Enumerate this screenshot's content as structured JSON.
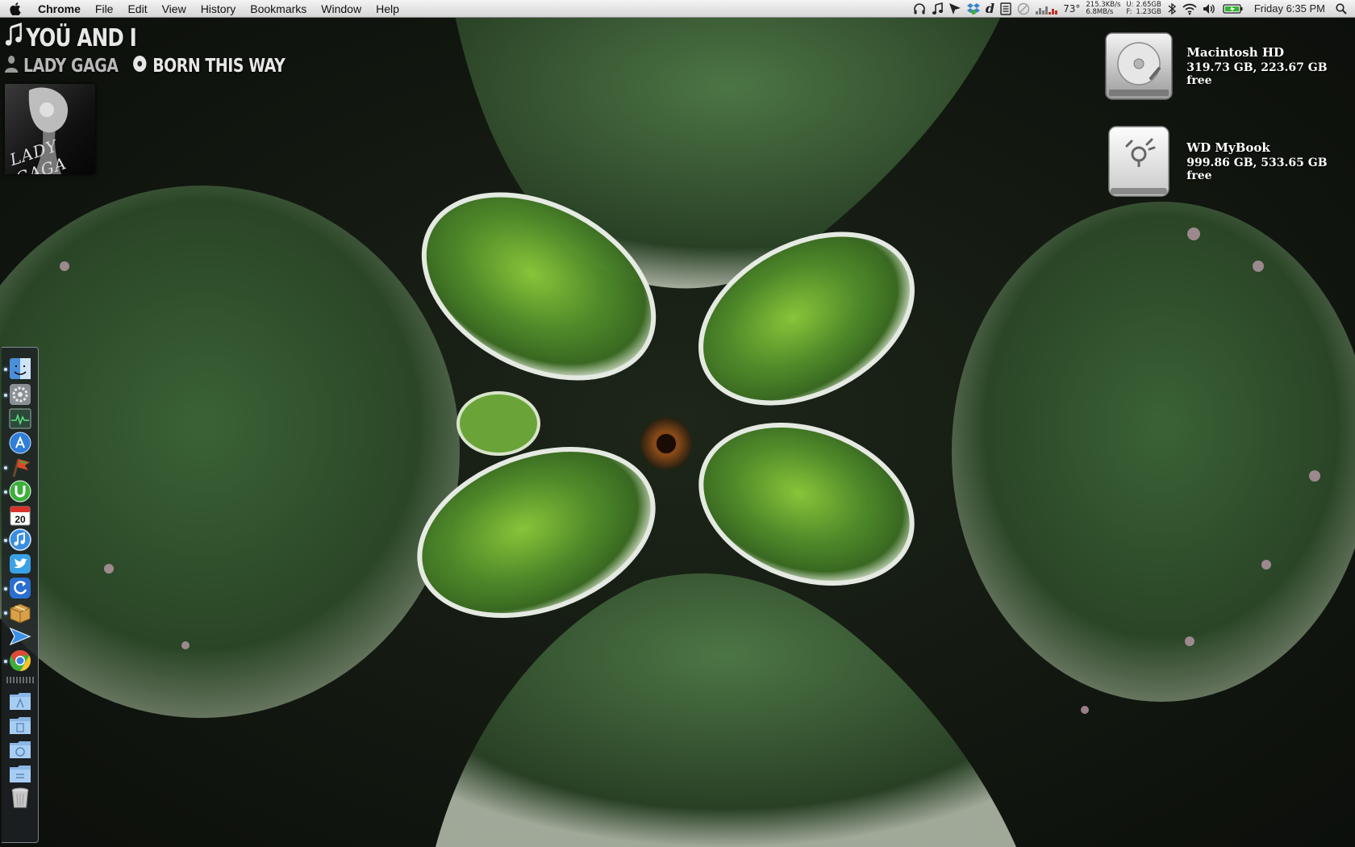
{
  "menubar": {
    "app_name": "Chrome",
    "menus": [
      "File",
      "Edit",
      "View",
      "History",
      "Bookmarks",
      "Window",
      "Help"
    ],
    "status": {
      "temperature": "73°",
      "net_up": "215.3KB/s",
      "net_down": "6.8MB/s",
      "mem_used_label": "U:",
      "mem_free_label": "F:",
      "mem_used": "2.65GB",
      "mem_free": "1.23GB",
      "clock": "Friday 6:35 PM"
    },
    "status_icons": [
      "headphones-icon",
      "music-note-icon",
      "cursor-icon",
      "dropbox-icon",
      "dictionary-icon",
      "notes-icon",
      "clock-icon",
      "cpu-bars-icon",
      "network-icon",
      "bluetooth-icon",
      "wifi-icon",
      "volume-icon",
      "battery-icon",
      "spotlight-icon"
    ]
  },
  "now_playing": {
    "song": "YOÜ AND I",
    "artist": "LADY GAGA",
    "album": "BORN THIS WAY",
    "cover_text": "LADY GAGA"
  },
  "drives": [
    {
      "name": "Macintosh HD",
      "free": "319.73 GB, 223.67 GB free",
      "icon": "hard-drive-icon"
    },
    {
      "name": "WD MyBook",
      "free": "999.86 GB, 533.65 GB free",
      "icon": "firewire-drive-icon"
    }
  ],
  "dock": {
    "items": [
      {
        "name": "finder",
        "running": true,
        "color": "#4a8fd8"
      },
      {
        "name": "system-preferences",
        "running": true,
        "color": "#8a8f96"
      },
      {
        "name": "activity-monitor",
        "running": false,
        "color": "#2b4a3a"
      },
      {
        "name": "app-store",
        "running": false,
        "color": "#2f7ed8"
      },
      {
        "name": "flag-app",
        "running": true,
        "color": "#d8492b"
      },
      {
        "name": "utorrent",
        "running": true,
        "color": "#3cae3c"
      },
      {
        "name": "ical",
        "running": false,
        "calendar_day": "20",
        "color": "#d8332b"
      },
      {
        "name": "itunes",
        "running": true,
        "color": "#3a8ee0"
      },
      {
        "name": "twitter",
        "running": false,
        "color": "#3aa1e6"
      },
      {
        "name": "sync-app",
        "running": true,
        "color": "#2a6fd0"
      },
      {
        "name": "archive-app",
        "running": true,
        "color": "#d8a048"
      },
      {
        "name": "send-app",
        "running": false,
        "color": "#3a8fe6"
      },
      {
        "name": "chrome",
        "running": true,
        "color": "#e04a3a"
      }
    ],
    "folders": [
      "applications-folder",
      "documents-folder",
      "downloads-folder",
      "stack-folder"
    ],
    "trash": "trash-icon"
  }
}
